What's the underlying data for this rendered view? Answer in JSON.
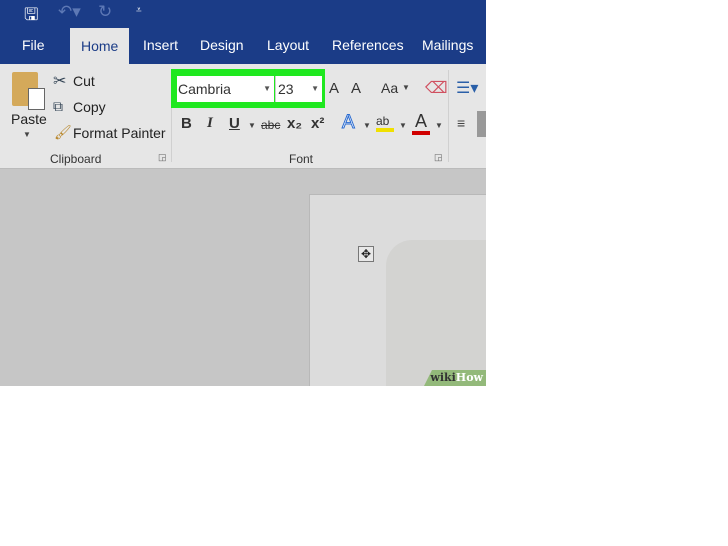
{
  "quick_access": {
    "save": "save-icon",
    "undo": "undo-icon",
    "redo": "redo-icon",
    "customize": "customize-icon"
  },
  "tabs": [
    {
      "label": "File"
    },
    {
      "label": "Home"
    },
    {
      "label": "Insert"
    },
    {
      "label": "Design"
    },
    {
      "label": "Layout"
    },
    {
      "label": "References"
    },
    {
      "label": "Mailings"
    }
  ],
  "clipboard": {
    "paste": "Paste",
    "cut": "Cut",
    "copy": "Copy",
    "format_painter": "Format Painter",
    "group_label": "Clipboard"
  },
  "font": {
    "name": "Cambria",
    "size": "23",
    "group_label": "Font",
    "bold": "B",
    "italic": "I",
    "underline": "U",
    "strike": "abc",
    "sub": "x₂",
    "sup": "x²",
    "grow": "A",
    "shrink": "A",
    "case": "Aa",
    "text_effects": "A",
    "font_color": "A",
    "highlight": "ab"
  },
  "highlight_color": "#1fe81f",
  "watermark": {
    "wiki": "wiki",
    "how": "How"
  }
}
